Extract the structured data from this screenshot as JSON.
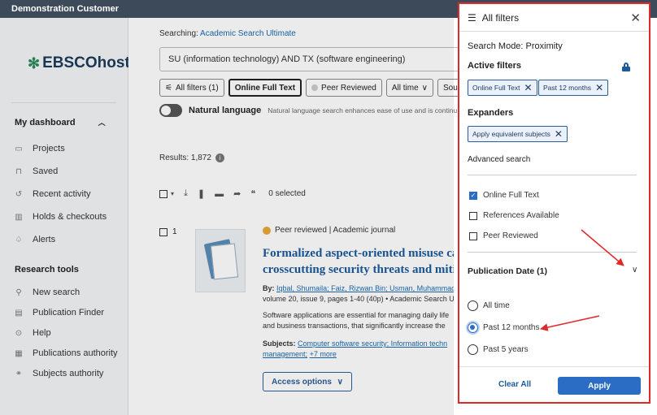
{
  "topbar": {
    "title": "Demonstration Customer"
  },
  "sidebar": {
    "logo": "EBSCOhost",
    "dashboard_heading": "My dashboard",
    "dashboard_items": [
      {
        "label": "Projects",
        "icon": "folder-icon"
      },
      {
        "label": "Saved",
        "icon": "bookmark-icon"
      },
      {
        "label": "Recent activity",
        "icon": "history-icon"
      },
      {
        "label": "Holds & checkouts",
        "icon": "books-icon"
      },
      {
        "label": "Alerts",
        "icon": "bell-icon"
      }
    ],
    "tools_heading": "Research tools",
    "tools_items": [
      {
        "label": "New search",
        "icon": "search-icon"
      },
      {
        "label": "Publication Finder",
        "icon": "document-icon"
      },
      {
        "label": "Help",
        "icon": "help-icon"
      },
      {
        "label": "Publications authority",
        "icon": "list-icon"
      },
      {
        "label": "Subjects authority",
        "icon": "tree-icon"
      }
    ]
  },
  "main": {
    "searching_label": "Searching:",
    "searching_db": "Academic Search Ultimate",
    "query": "SU (information technology) AND TX (software engineering)",
    "chips": {
      "all_filters": "All filters (1)",
      "online_full_text": "Online Full Text",
      "peer_reviewed": "Peer Reviewed",
      "all_time": "All time",
      "source": "Sour"
    },
    "natural_language_label": "Natural language",
    "natural_language_desc": "Natural language search enhances ease of use and is continu",
    "results_label": "Results: 1,872",
    "selected_label": "0 selected",
    "result": {
      "number": "1",
      "type": "Peer reviewed | Academic journal",
      "title_line1": "Formalized aspect-oriented misuse ca",
      "title_line2": "crosscutting security threats and miti",
      "by_label": "By:",
      "authors": "Iqbal, Shumaila; Faiz, Rizwan Bin; Usman, Muhammad",
      "source_line": "volume 20, issue 9, pages 1-40 (40p) • Academic Search U",
      "abstract_1": "Software applications are essential for managing daily life",
      "abstract_2": "and business transactions, that significantly increase the",
      "subjects_label": "Subjects:",
      "subjects_text": "Computer software security; Information techn",
      "subjects_more1": "management;",
      "subjects_more2": "+7 more",
      "access_options": "Access options"
    }
  },
  "panel": {
    "title": "All filters",
    "search_mode": "Search Mode: Proximity",
    "active_filters": "Active filters",
    "active_chips": [
      "Online Full Text",
      "Past 12 months"
    ],
    "expanders": "Expanders",
    "expander_chip": "Apply equivalent subjects",
    "advanced_search": "Advanced search",
    "checkboxes": [
      {
        "label": "Online Full Text",
        "checked": true
      },
      {
        "label": "References Available",
        "checked": false
      },
      {
        "label": "Peer Reviewed",
        "checked": false
      }
    ],
    "publication_date": "Publication Date (1)",
    "date_options": [
      {
        "label": "All time",
        "selected": false
      },
      {
        "label": "Past 12 months",
        "selected": true
      },
      {
        "label": "Past 5 years",
        "selected": false
      }
    ],
    "clear_all": "Clear All",
    "apply": "Apply"
  },
  "colors": {
    "accent": "#2b6cc4",
    "highlight": "#e02a2a",
    "topbar": "#3d4a5a"
  }
}
